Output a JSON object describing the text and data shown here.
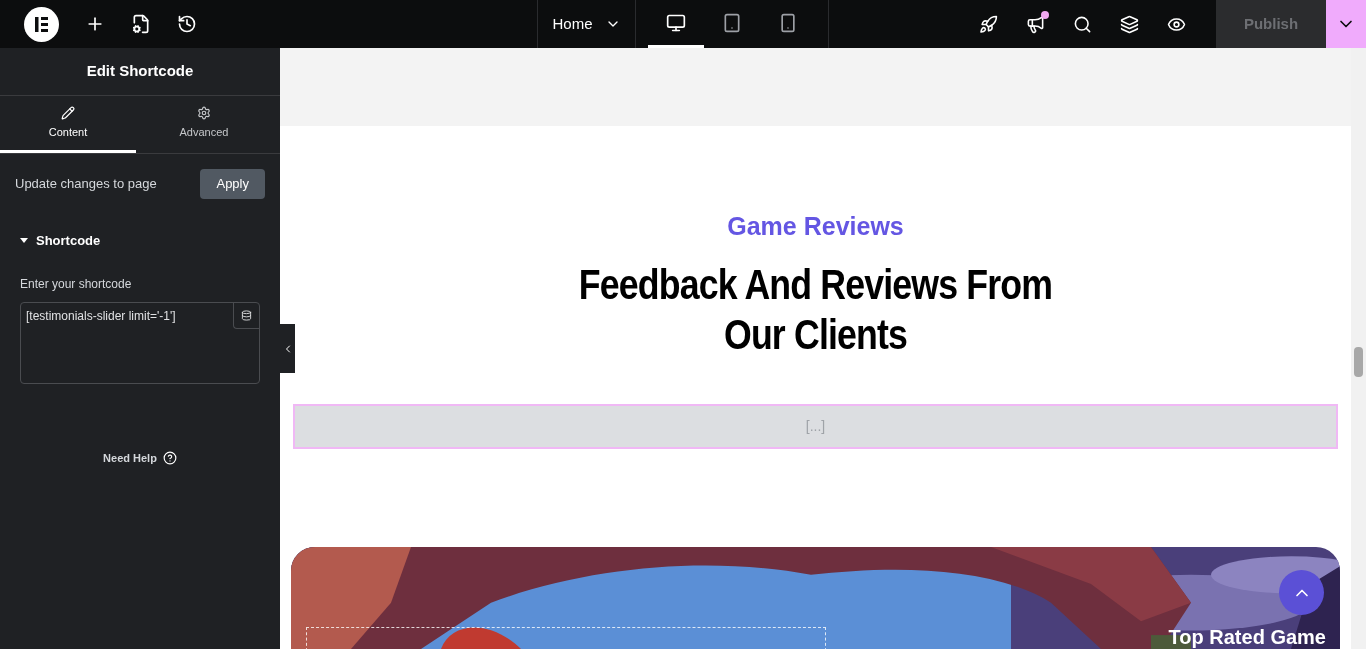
{
  "topbar": {
    "page": "Home",
    "devices": [
      {
        "kind": "desktop",
        "selected": true
      },
      {
        "kind": "tablet",
        "selected": false
      },
      {
        "kind": "mobile",
        "selected": false
      }
    ],
    "notification": true,
    "publish": "Publish"
  },
  "sidebar": {
    "title": "Edit Shortcode",
    "tabs": [
      {
        "kind": "content",
        "label": "Content",
        "selected": true
      },
      {
        "kind": "advanced",
        "label": "Advanced",
        "selected": false
      }
    ],
    "update_text": "Update changes to page",
    "apply": "Apply",
    "section": {
      "title": "Shortcode",
      "expanded": true,
      "field_label": "Enter your shortcode",
      "value": "[testimonials-slider limit='-1']"
    },
    "help": "Need Help"
  },
  "canvas": {
    "subtitle": "Game Reviews",
    "heading_lines": [
      "Feedback And Reviews From",
      "Our Clients"
    ],
    "shortcode_preview": "[...]",
    "hero": {
      "kind": "picture",
      "title": "Top Rated Game"
    }
  }
}
